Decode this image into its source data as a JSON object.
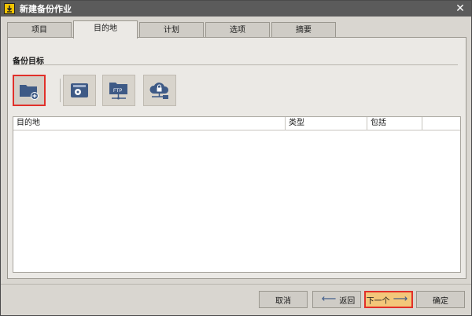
{
  "window": {
    "title": "新建备份作业"
  },
  "tabs": [
    {
      "label": "项目"
    },
    {
      "label": "目的地"
    },
    {
      "label": "计划"
    },
    {
      "label": "选项"
    },
    {
      "label": "摘要"
    }
  ],
  "section": {
    "title": "备份目标"
  },
  "destinations": [
    {
      "icon": "folder-add-icon"
    },
    {
      "icon": "disk-drive-icon"
    },
    {
      "icon": "ftp-folder-icon",
      "text": "FTP"
    },
    {
      "icon": "cloud-lock-icon"
    }
  ],
  "table": {
    "columns": [
      "目的地",
      "类型",
      "包括"
    ]
  },
  "buttons": {
    "cancel": "取消",
    "back": "返回",
    "next": "下一个",
    "ok": "确定"
  },
  "colors": {
    "icon_blue": "#3e5a86",
    "highlight_red": "#e1302a",
    "titlebar": "#5b5b5b"
  }
}
